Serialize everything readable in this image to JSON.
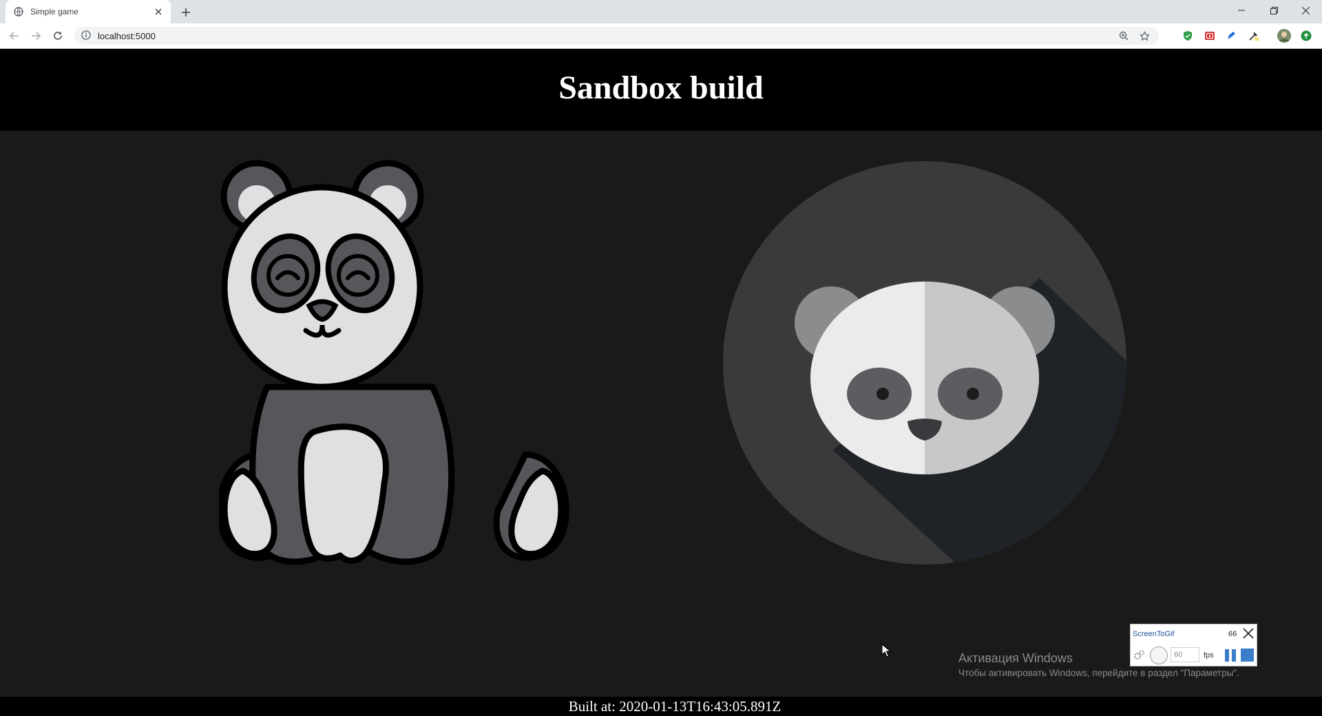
{
  "browser": {
    "tab": {
      "title": "Simple game",
      "favicon": "globe-icon"
    },
    "address": {
      "url": "localhost:5000"
    },
    "icons": [
      "back-icon",
      "forward-icon",
      "reload-icon",
      "info-icon",
      "zoom-icon",
      "star-icon",
      "shield-extension-icon",
      "video-extension-icon",
      "pen-extension-icon",
      "eyedropper-extension-icon",
      "profile-avatar",
      "update-icon"
    ]
  },
  "page": {
    "title": "Sandbox build",
    "footer": "Built at: 2020-01-13T16:43:05.891Z",
    "colors": {
      "header_bg": "#000000",
      "body_bg": "#1a1a1a",
      "title": "#ffffff"
    }
  },
  "overlay": {
    "activation_title": "Активация Windows",
    "activation_sub": "Чтобы активировать Windows, перейдите в раздел \"Параметры\".",
    "screentogif": {
      "title": "ScreenToGif",
      "frames": "66",
      "fps_value": "60",
      "fps_label": "fps"
    }
  }
}
